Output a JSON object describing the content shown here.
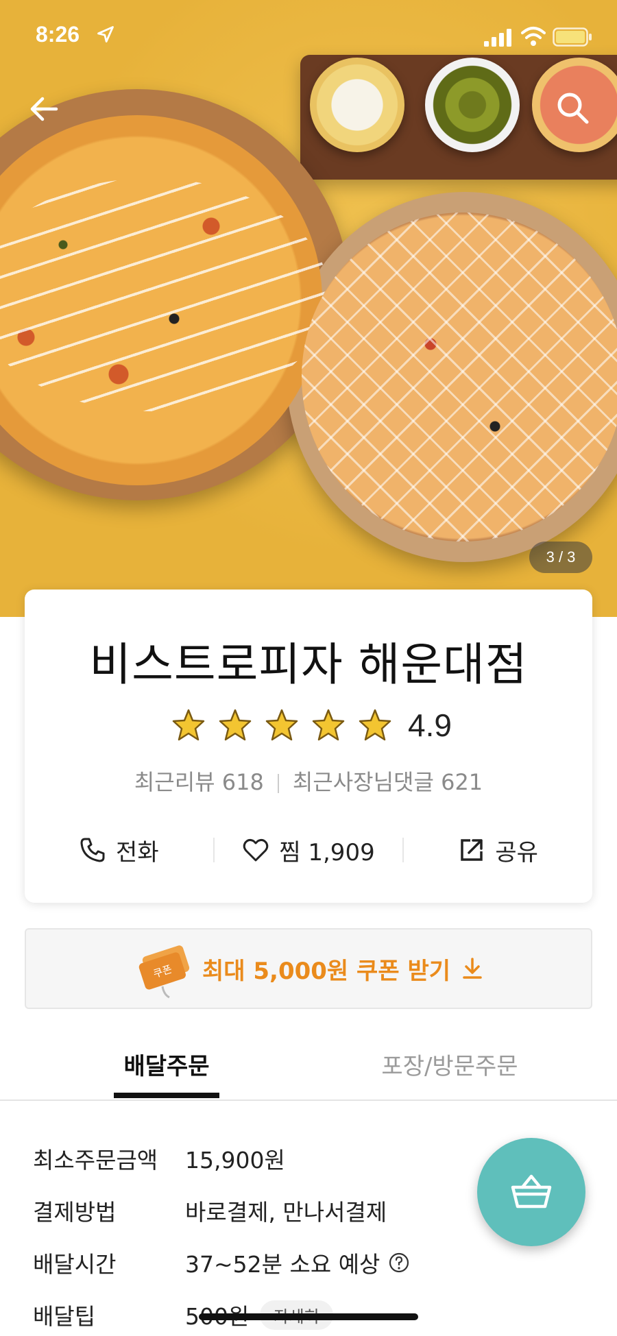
{
  "status_bar": {
    "time": "8:26"
  },
  "hero": {
    "page_indicator": "3 / 3"
  },
  "store": {
    "name": "비스트로피자 해운대점",
    "rating": "4.9",
    "stars": 5,
    "recent_reviews": "최근리뷰 618",
    "owner_replies": "최근사장님댓글 621"
  },
  "actions": {
    "call_label": "전화",
    "favorite_label": "찜 1,909",
    "share_label": "공유"
  },
  "coupon": {
    "label": "최대 5,000원 쿠폰 받기",
    "icon_text": "쿠폰"
  },
  "tabs": {
    "delivery": "배달주문",
    "pickup": "포장/방문주문"
  },
  "delivery_info": {
    "min_order_label": "최소주문금액",
    "min_order_value": "15,900원",
    "payment_label": "결제방법",
    "payment_value": "바로결제, 만나서결제",
    "time_label": "배달시간",
    "time_value": "37~52분 소요 예상",
    "tip_label": "배달팁",
    "tip_value": "500원",
    "tip_detail": "자세히"
  },
  "colors": {
    "hero_bg": "#e7b23a",
    "coupon_accent": "#ea8b1c",
    "cart_button": "#5fbfbb",
    "star": "#f3c531"
  },
  "icons": [
    "location-arrow-icon",
    "signal-icon",
    "wifi-icon",
    "battery-icon",
    "back-arrow-icon",
    "search-icon",
    "star-icon",
    "phone-icon",
    "heart-icon",
    "share-icon",
    "coupon-icon",
    "download-icon",
    "help-icon",
    "cart-icon"
  ]
}
